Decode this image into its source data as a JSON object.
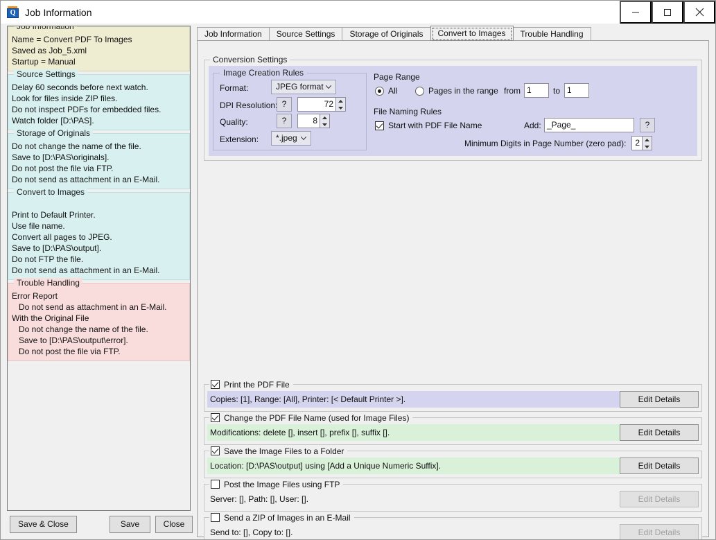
{
  "window": {
    "title": "Job Information",
    "icon": "app-icon",
    "minimize": "─",
    "maximize": "□",
    "close": "✕"
  },
  "sidebar": {
    "groups": [
      {
        "legend": "Job Information",
        "tone": "yellow",
        "lines": [
          "Name = Convert PDF To Images",
          "Saved as Job_5.xml",
          "Startup = Manual"
        ]
      },
      {
        "legend": "Source Settings",
        "tone": "cyan",
        "lines": [
          "Delay 60 seconds before next watch.",
          "Look for files inside ZIP files.",
          "Do not inspect PDFs for embedded files.",
          "Watch folder [D:\\PAS]."
        ]
      },
      {
        "legend": "Storage of Originals",
        "tone": "cyan",
        "lines": [
          "Do not change the name of the file.",
          "Save to [D:\\PAS\\originals].",
          "Do not post the file via FTP.",
          "Do not send as attachment in an E-Mail."
        ]
      },
      {
        "legend": "Convert to Images",
        "tone": "cyan",
        "lines": [
          "",
          "Print to Default Printer.",
          "Use file name.",
          "Convert all pages to JPEG.",
          "Save to [D:\\PAS\\output].",
          "Do not FTP the file.",
          "Do not send as attachment in an E-Mail."
        ]
      },
      {
        "legend": "Trouble Handling",
        "tone": "pink",
        "lines": [
          "Error Report",
          "   Do not send as attachment in an E-Mail.",
          "With the Original File",
          "   Do not change the name of the file.",
          "   Save to [D:\\PAS\\output\\error].",
          "   Do not post the file via FTP."
        ]
      }
    ]
  },
  "footer": {
    "save_and_close": "Save & Close",
    "save": "Save",
    "close": "Close"
  },
  "tabs": [
    {
      "label": "Job Information",
      "active": false
    },
    {
      "label": "Source Settings",
      "active": false
    },
    {
      "label": "Storage of Originals",
      "active": false
    },
    {
      "label": "Convert to Images",
      "active": true
    },
    {
      "label": "Trouble Handling",
      "active": false
    }
  ],
  "conversion": {
    "legend": "Conversion Settings",
    "image_rules": {
      "legend": "Image Creation Rules",
      "format_label": "Format:",
      "format_value": "JPEG format",
      "dpi_label": "DPI Resolution:",
      "dpi_help": "?",
      "dpi_value": "72",
      "quality_label": "Quality:",
      "quality_help": "?",
      "quality_value": "8",
      "extension_label": "Extension:",
      "extension_value": "*.jpeg"
    },
    "page_range": {
      "legend": "Page Range",
      "all_label": "All",
      "all_selected": true,
      "range_label": "Pages in the range",
      "from_label": "from",
      "from_value": "1",
      "to_label": "to",
      "to_value": "1"
    },
    "file_naming": {
      "legend": "File Naming Rules",
      "start_with_label": "Start with PDF File Name",
      "start_with_checked": true,
      "add_label": "Add:",
      "add_value": "_Page_",
      "add_help": "?",
      "min_digits_label": "Minimum Digits in Page Number (zero pad):",
      "min_digits_value": "2"
    }
  },
  "actions": [
    {
      "legend": "Print the PDF File",
      "checked": true,
      "tone": "purple",
      "summary": "Copies: [1], Range: [All], Printer: [< Default Printer >].",
      "button": "Edit Details",
      "button_enabled": true
    },
    {
      "legend": "Change the PDF File Name (used for Image Files)",
      "checked": true,
      "tone": "green",
      "summary": "Modifications: delete [], insert [], prefix [], suffix [].",
      "button": "Edit Details",
      "button_enabled": true
    },
    {
      "legend": "Save the Image Files to a Folder",
      "checked": true,
      "tone": "green",
      "summary": "Location: [D:\\PAS\\output] using [Add a Unique Numeric Suffix].",
      "button": "Edit Details",
      "button_enabled": true
    },
    {
      "legend": "Post the Image Files using FTP",
      "checked": false,
      "tone": "plain",
      "summary": "Server: [], Path: [], User: [].",
      "button": "Edit Details",
      "button_enabled": false
    },
    {
      "legend": "Send a ZIP of Images in an E-Mail",
      "checked": false,
      "tone": "plain",
      "summary": "Send to: [], Copy to: [].",
      "button": "Edit Details",
      "button_enabled": false
    }
  ],
  "colors": {
    "accent_purple": "#d4d4ee",
    "accent_green": "#d9f0d9",
    "summary_yellow": "#eeedd2",
    "summary_cyan": "#d8f1f0",
    "summary_pink": "#f9dcdc",
    "window_chrome": "#f0f0f0"
  }
}
